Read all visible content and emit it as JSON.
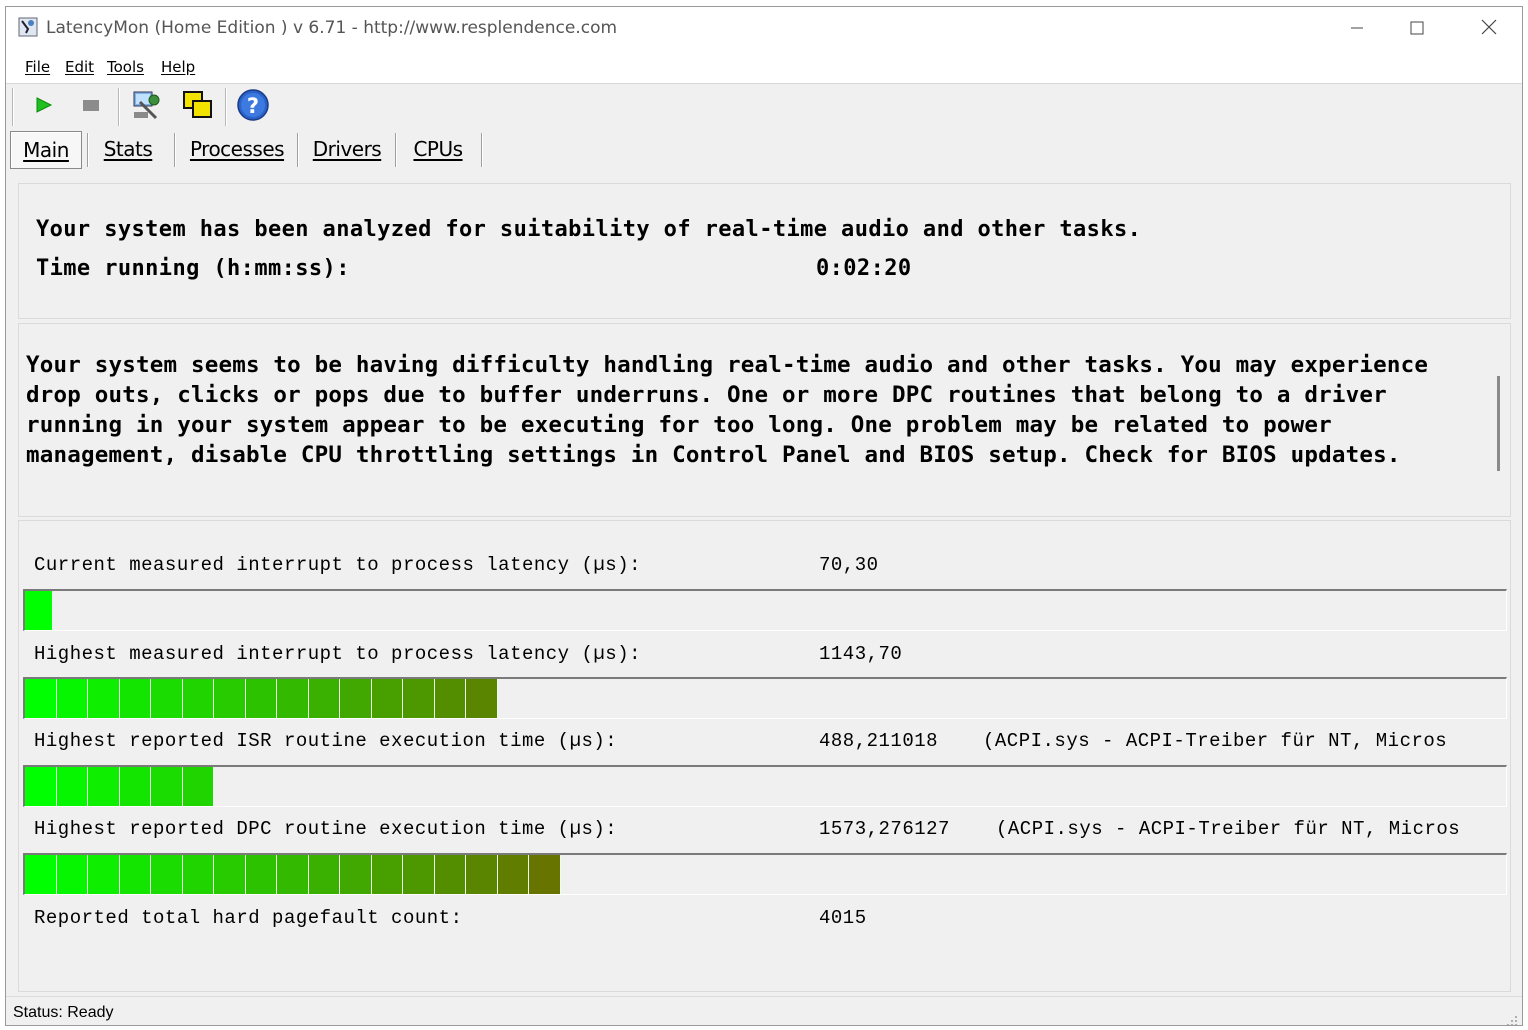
{
  "window": {
    "title": "LatencyMon  (Home Edition )  v 6.71 - http://www.resplendence.com",
    "minimize_icon": "minimize-icon",
    "maximize_icon": "maximize-icon",
    "close_icon": "close-icon"
  },
  "menu": {
    "items": [
      {
        "label": "File"
      },
      {
        "label": "Edit"
      },
      {
        "label": "Tools"
      },
      {
        "label": "Help"
      }
    ]
  },
  "toolbar": {
    "buttons": [
      {
        "icon": "play-icon",
        "color": "#1fbf1f"
      },
      {
        "icon": "stop-icon",
        "color": "#8c8c8c"
      },
      {
        "icon": "drivers-tool-icon"
      },
      {
        "icon": "copy-windows-icon"
      },
      {
        "icon": "help-icon",
        "color": "#2a62c9"
      }
    ]
  },
  "tabs": [
    {
      "label": "Main",
      "active": true
    },
    {
      "label": "Stats",
      "active": false
    },
    {
      "label": "Processes",
      "active": false
    },
    {
      "label": "Drivers",
      "active": false
    },
    {
      "label": "CPUs",
      "active": false
    }
  ],
  "summary": {
    "headline": "Your system has been analyzed for suitability of real-time audio and other tasks.",
    "time_label": "Time running (h:mm:ss):",
    "time_value": "0:02:20"
  },
  "message": {
    "text": "Your system seems to be having difficulty handling real-time audio and other tasks. You may experience drop outs, clicks or pops due to buffer underruns. One or more DPC routines that belong to a driver running in your system appear to be executing for too long. One problem may be related to power management, disable CPU throttling settings in Control Panel and BIOS setup. Check for BIOS updates."
  },
  "measurements": {
    "current": {
      "label": "Current measured interrupt to process latency (µs):",
      "value": "70,30",
      "bar_segments": 1
    },
    "highest": {
      "label": "Highest measured interrupt to process latency (µs):",
      "value": "1143,70",
      "bar_segments": 15
    },
    "isr": {
      "label": "Highest reported ISR routine execution time (µs):",
      "value": "488,211018",
      "detail": "(ACPI.sys - ACPI-Treiber für NT, Micros",
      "bar_segments": 6
    },
    "dpc": {
      "label": "Highest reported DPC routine execution time (µs):",
      "value": "1573,276127",
      "detail": "(ACPI.sys - ACPI-Treiber für NT, Micros",
      "bar_segments": 17
    },
    "pagefault": {
      "label": "Reported total hard pagefault count:",
      "value": "4015"
    }
  },
  "status": {
    "text": "Status: Ready"
  },
  "colors": {
    "bar_start": "#00ff00",
    "bar_end": "#7a5a00"
  }
}
